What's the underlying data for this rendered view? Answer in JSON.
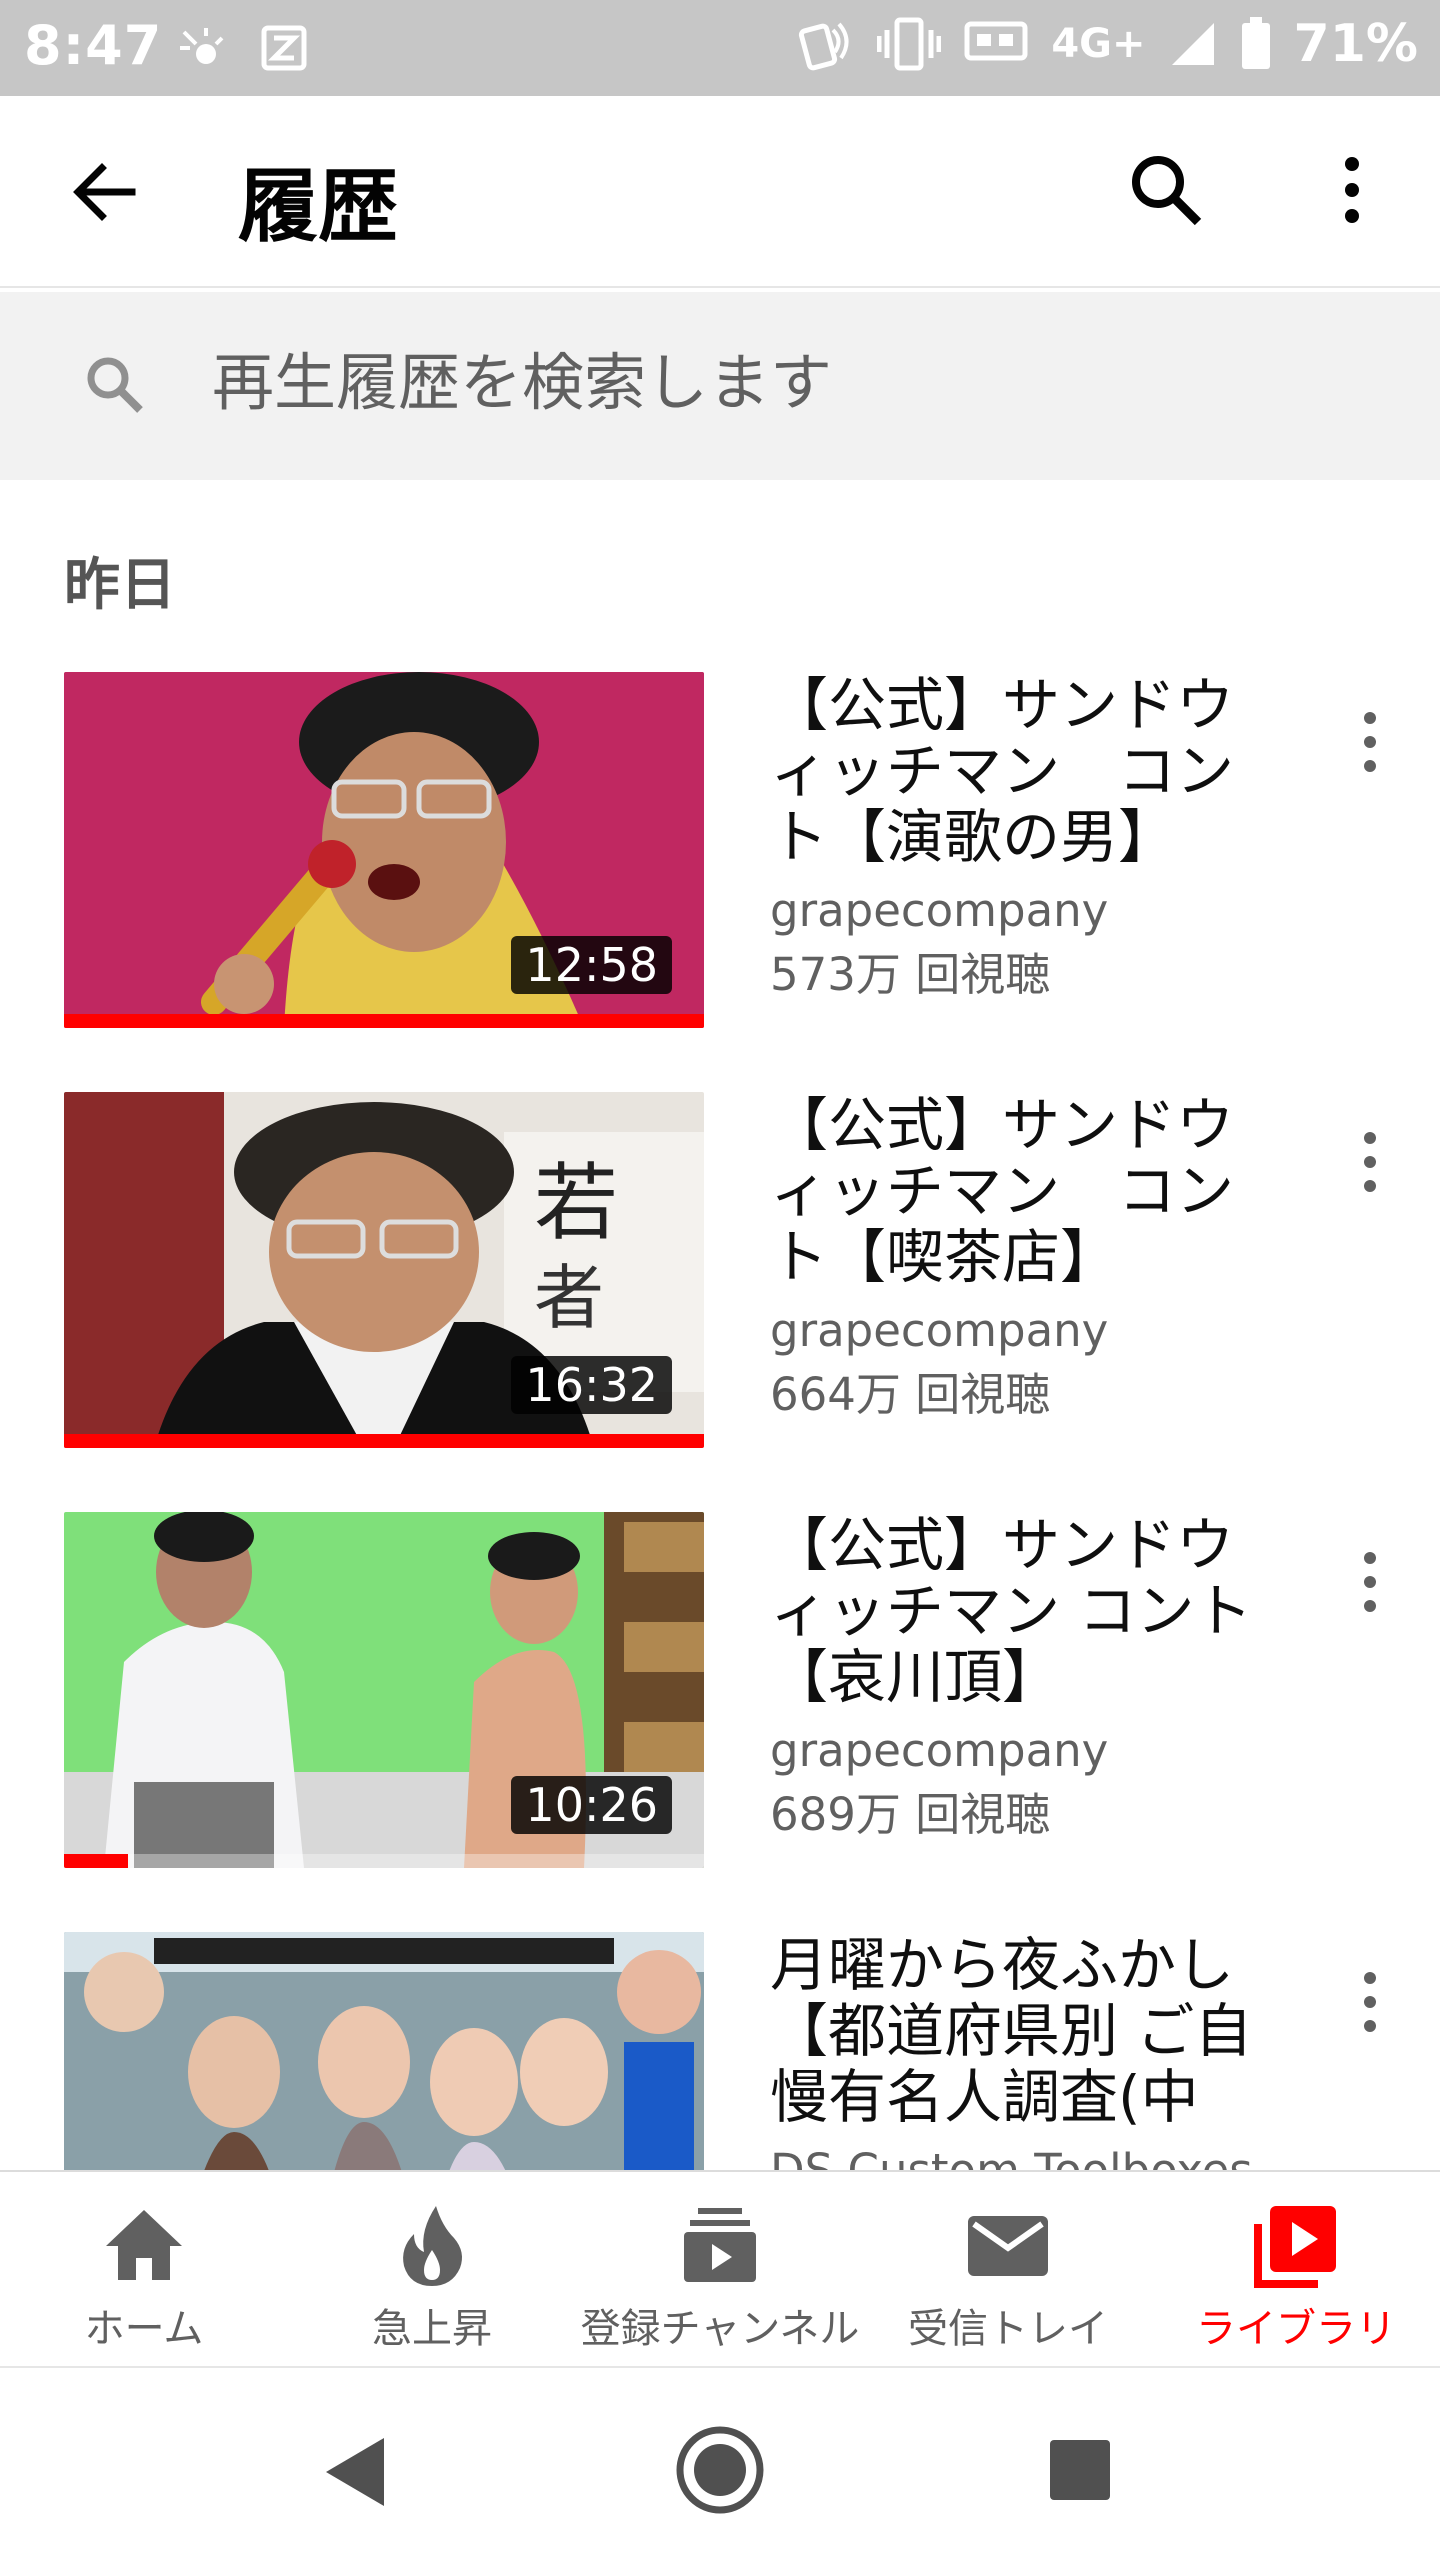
{
  "status_bar": {
    "time": "8:47",
    "network": "4G+",
    "battery": "71%"
  },
  "app_bar": {
    "title": "履歴"
  },
  "history_search": {
    "placeholder": "再生履歴を検索します"
  },
  "section": {
    "heading": "昨日"
  },
  "videos": [
    {
      "title": "【公式】サンドウィッチマン　コント【演歌の男】",
      "channel": "grapecompany",
      "views": "573万 回視聴",
      "duration": "12:58",
      "watched_fraction": 1.0
    },
    {
      "title": "【公式】サンドウィッチマン　コント【喫茶店】",
      "channel": "grapecompany",
      "views": "664万 回視聴",
      "duration": "16:32",
      "watched_fraction": 1.0
    },
    {
      "title": "【公式】サンドウィッチマン コント【哀川頂】",
      "channel": "grapecompany",
      "views": "689万 回視聴",
      "duration": "10:26",
      "watched_fraction": 0.1
    },
    {
      "title": "月曜から夜ふかし【都道府県別 ご自慢有名人調査(中部…",
      "channel": "DS Custom Toolboxes",
      "views": "",
      "duration": "",
      "watched_fraction": 0
    }
  ],
  "bottom_nav": {
    "items": [
      {
        "label": "ホーム",
        "icon": "home-icon",
        "active": false
      },
      {
        "label": "急上昇",
        "icon": "trending-flame-icon",
        "active": false
      },
      {
        "label": "登録チャンネル",
        "icon": "subscriptions-icon",
        "active": false
      },
      {
        "label": "受信トレイ",
        "icon": "inbox-mail-icon",
        "active": false
      },
      {
        "label": "ライブラリ",
        "icon": "library-icon",
        "active": true
      }
    ]
  },
  "colors": {
    "accent": "#ff0000",
    "status_bar": "#c6c6c6",
    "search_row": "#f2f2f2",
    "secondary_text": "#606060",
    "nav_inactive": "#606060"
  }
}
